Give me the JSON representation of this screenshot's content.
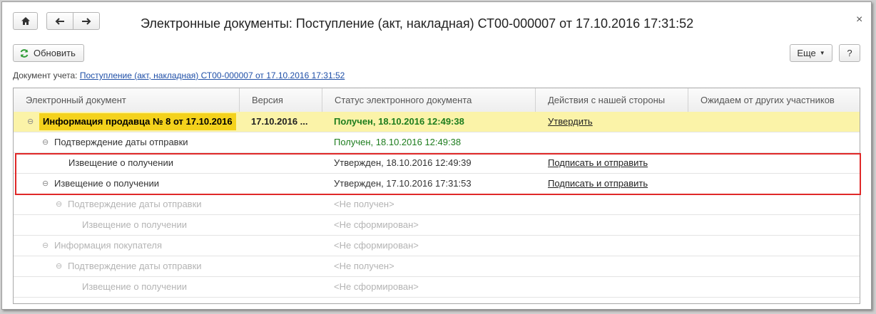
{
  "window": {
    "title": "Электронные документы: Поступление (акт, накладная) СТ00-000007 от 17.10.2016 17:31:52"
  },
  "toolbar": {
    "refresh_label": "Обновить",
    "more_label": "Еще",
    "help_label": "?"
  },
  "document": {
    "label": "Документ учета:",
    "link": "Поступление (акт, накладная) СТ00-000007 от 17.10.2016 17:31:52"
  },
  "table": {
    "headers": [
      "Электронный документ",
      "Версия",
      "Статус электронного документа",
      "Действия с нашей стороны",
      "Ожидаем от других участников"
    ],
    "rows": [
      {
        "name": "Информация продавца № 8 от 17.10.2016",
        "version": "17.10.2016 ...",
        "status": "Получен, 18.10.2016 12:49:38",
        "action": "Утвердить"
      },
      {
        "name": "Подтверждение даты отправки",
        "version": "",
        "status": "Получен, 18.10.2016 12:49:38",
        "action": ""
      },
      {
        "name": "Извещение о получении",
        "version": "",
        "status": "Утвержден, 18.10.2016 12:49:39",
        "action": "Подписать и отправить"
      },
      {
        "name": "Извещение о получении",
        "version": "",
        "status": "Утвержден, 17.10.2016 17:31:53",
        "action": "Подписать и отправить"
      },
      {
        "name": "Подтверждение даты отправки",
        "version": "",
        "status": "<Не получен>",
        "action": ""
      },
      {
        "name": "Извещение о получении",
        "version": "",
        "status": "<Не сформирован>",
        "action": ""
      },
      {
        "name": "Информация покупателя",
        "version": "",
        "status": "<Не сформирован>",
        "action": ""
      },
      {
        "name": "Подтверждение даты отправки",
        "version": "",
        "status": "<Не получен>",
        "action": ""
      },
      {
        "name": "Извещение о получении",
        "version": "",
        "status": "<Не сформирован>",
        "action": ""
      }
    ]
  },
  "icons": {
    "home": "home-icon",
    "back": "arrow-left-icon",
    "forward": "arrow-right-icon",
    "refresh": "refresh-icon",
    "close": "close-icon",
    "collapse": "collapse-icon"
  },
  "colors": {
    "selected_row": "#fbf3a8",
    "highlight": "#f4d21c",
    "status_green": "#1e7d1e",
    "inactive_text": "#b4b4b4",
    "annotation_red": "#e02828"
  }
}
